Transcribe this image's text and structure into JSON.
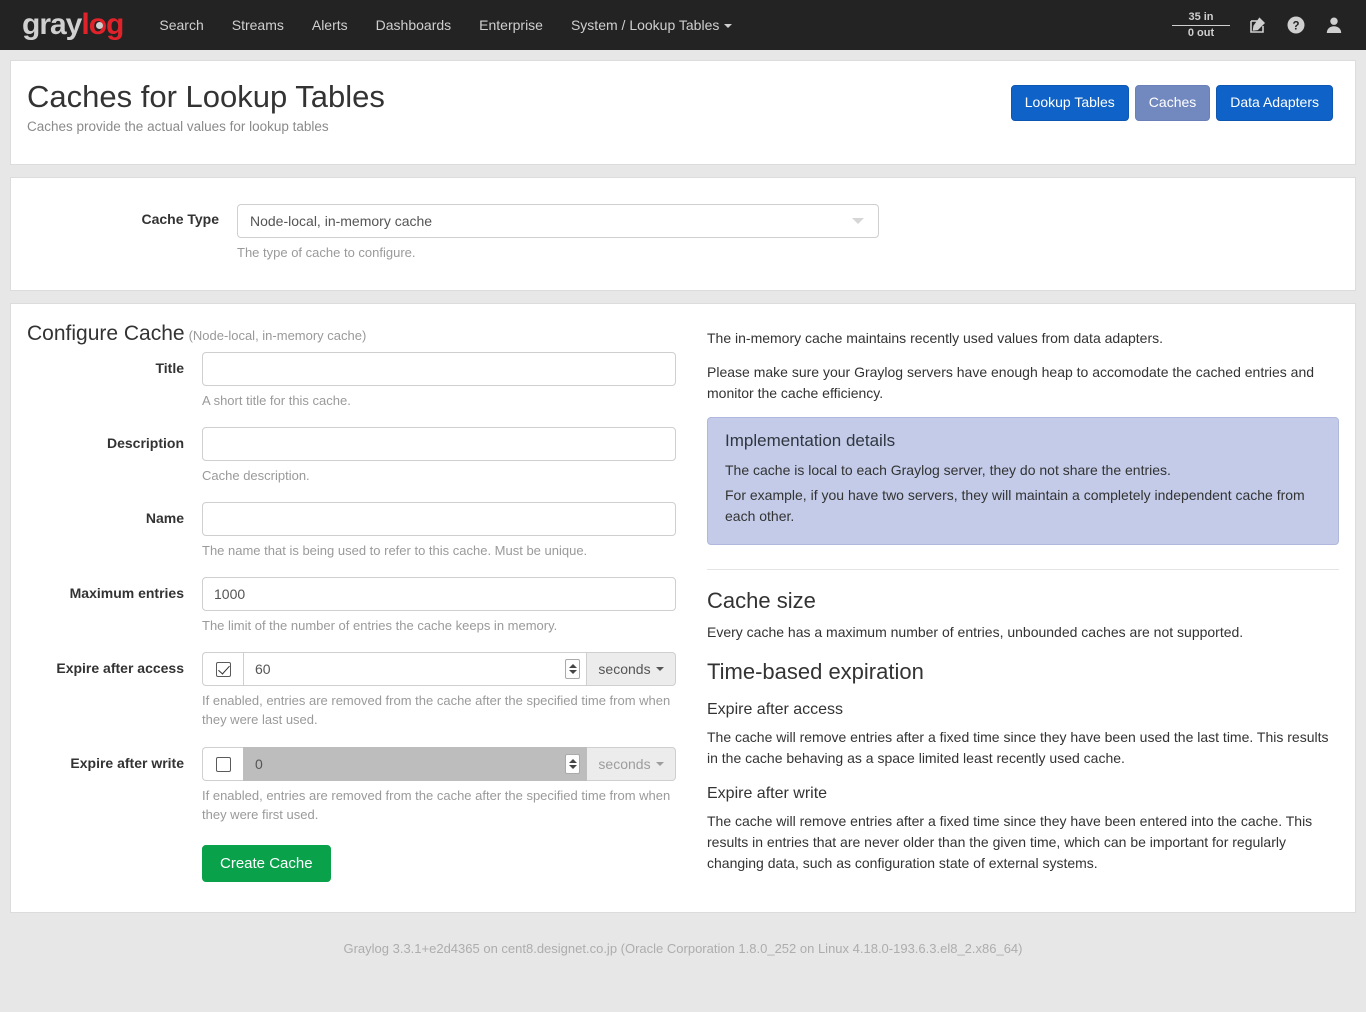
{
  "navbar": {
    "brand": {
      "gray": "gray",
      "red": "log"
    },
    "links": [
      {
        "label": "Search",
        "has_caret": false
      },
      {
        "label": "Streams",
        "has_caret": false
      },
      {
        "label": "Alerts",
        "has_caret": false
      },
      {
        "label": "Dashboards",
        "has_caret": false
      },
      {
        "label": "Enterprise",
        "has_caret": false
      },
      {
        "label": "System / Lookup Tables",
        "has_caret": true
      }
    ],
    "throughput": {
      "in": "35 in",
      "out": "0 out"
    },
    "icons": [
      "edit-icon",
      "help-icon",
      "user-icon"
    ]
  },
  "header": {
    "title": "Caches for Lookup Tables",
    "subtitle": "Caches provide the actual values for lookup tables",
    "buttons": [
      {
        "label": "Lookup Tables",
        "state": "default"
      },
      {
        "label": "Caches",
        "state": "active"
      },
      {
        "label": "Data Adapters",
        "state": "default"
      }
    ]
  },
  "cache_type": {
    "label": "Cache Type",
    "value": "Node-local, in-memory cache",
    "help": "The type of cache to configure."
  },
  "configure": {
    "title": "Configure Cache",
    "subtitle": "(Node-local, in-memory cache)",
    "fields": {
      "title": {
        "label": "Title",
        "value": "",
        "help": "A short title for this cache."
      },
      "description": {
        "label": "Description",
        "value": "",
        "help": "Cache description."
      },
      "name": {
        "label": "Name",
        "value": "",
        "help": "The name that is being used to refer to this cache. Must be unique."
      },
      "max_entries": {
        "label": "Maximum entries",
        "value": "1000",
        "help": "The limit of the number of entries the cache keeps in memory."
      },
      "expire_after_access": {
        "label": "Expire after access",
        "checked": true,
        "value": "60",
        "unit": "seconds",
        "help": "If enabled, entries are removed from the cache after the specified time from when they were last used."
      },
      "expire_after_write": {
        "label": "Expire after write",
        "checked": false,
        "value": "0",
        "unit": "seconds",
        "help": "If enabled, entries are removed from the cache after the specified time from when they were first used."
      }
    },
    "submit_label": "Create Cache"
  },
  "docs": {
    "intro_1": "The in-memory cache maintains recently used values from data adapters.",
    "intro_2": "Please make sure your Graylog servers have enough heap to accomodate the cached entries and monitor the cache efficiency.",
    "impl": {
      "title": "Implementation details",
      "line_1": "The cache is local to each Graylog server, they do not share the entries.",
      "line_2": "For example, if you have two servers, they will maintain a completely independent cache from each other."
    },
    "cache_size": {
      "heading": "Cache size",
      "text": "Every cache has a maximum number of entries, unbounded caches are not supported."
    },
    "expiration": {
      "heading": "Time-based expiration",
      "access": {
        "heading": "Expire after access",
        "text": "The cache will remove entries after a fixed time since they have been used the last time. This results in the cache behaving as a space limited least recently used cache."
      },
      "write": {
        "heading": "Expire after write",
        "text": "The cache will remove entries after a fixed time since they have been entered into the cache. This results in entries that are never older than the given time, which can be important for regularly changing data, such as configuration state of external systems."
      }
    }
  },
  "footer": {
    "text": "Graylog 3.3.1+e2d4365 on cent8.designet.co.jp (Oracle Corporation 1.8.0_252 on Linux 4.18.0-193.6.3.el8_2.x86_64)"
  },
  "colors": {
    "navbar_bg": "#232323",
    "brand_red": "#e0222a",
    "primary": "#0f62c7",
    "active": "#7289c0",
    "success": "#0aa14b",
    "info_bg": "#c3cbe8"
  }
}
